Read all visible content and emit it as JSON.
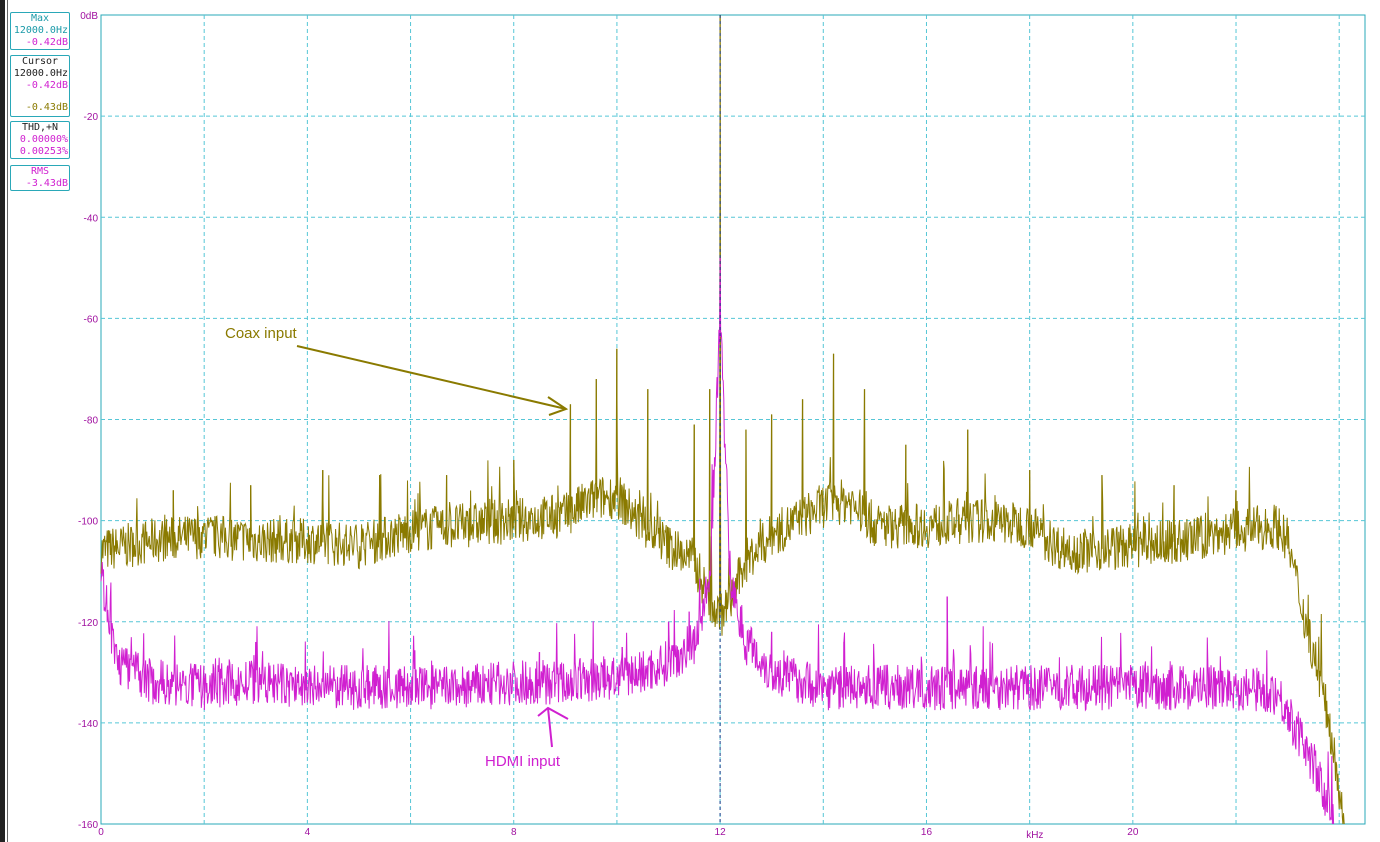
{
  "colors": {
    "coax": "#8a7a00",
    "hdmi": "#d020d0",
    "grid": "#56c6d6",
    "axis_text": "#a010a0",
    "frame": "#2aa8b8",
    "cursor": "#1b3b8a"
  },
  "panel": {
    "max": {
      "title": "Max",
      "freq": "12000.0Hz",
      "level": "-0.42dB"
    },
    "cursor": {
      "title": "Cursor",
      "freq": "12000.0Hz",
      "level_hdmi": "-0.42dB",
      "level_coax": "-0.43dB"
    },
    "thd": {
      "title": "THD,+N",
      "hdmi": "0.00000%",
      "coax": "0.00253%"
    },
    "rms": {
      "title": "RMS",
      "value": "-3.43dB"
    }
  },
  "chart_data": {
    "type": "line",
    "xlabel": "kHz",
    "ylabel": "",
    "xlim": [
      0,
      24.5
    ],
    "ylim": [
      -160,
      0
    ],
    "x_ticks": [
      "0",
      "4",
      "8",
      "12",
      "16",
      "20"
    ],
    "y_ticks": [
      "0dB",
      "-20",
      "-40",
      "-60",
      "-80",
      "-100",
      "-120",
      "-140",
      "-160"
    ],
    "grid": true,
    "cursor_x": 12,
    "series": [
      {
        "key": "coax",
        "noise_floor": [
          [
            0,
            -106
          ],
          [
            1,
            -104
          ],
          [
            2,
            -103
          ],
          [
            3,
            -104
          ],
          [
            4,
            -104
          ],
          [
            5,
            -105
          ],
          [
            6,
            -102
          ],
          [
            7,
            -101
          ],
          [
            8,
            -100
          ],
          [
            9,
            -99
          ],
          [
            9.5,
            -96
          ],
          [
            10,
            -95
          ],
          [
            10.5,
            -101
          ],
          [
            11,
            -105
          ],
          [
            11.5,
            -108
          ],
          [
            11.8,
            -116
          ],
          [
            12,
            -119
          ],
          [
            12.2,
            -116
          ],
          [
            12.5,
            -108
          ],
          [
            13,
            -103
          ],
          [
            13.5,
            -100
          ],
          [
            14,
            -97
          ],
          [
            14.5,
            -96
          ],
          [
            15,
            -101
          ],
          [
            16,
            -101
          ],
          [
            17,
            -100
          ],
          [
            18,
            -101
          ],
          [
            18.5,
            -105
          ],
          [
            19,
            -106
          ],
          [
            20,
            -105
          ],
          [
            21,
            -104
          ],
          [
            22,
            -102
          ],
          [
            22.8,
            -101
          ],
          [
            23,
            -104
          ],
          [
            23.3,
            -118
          ],
          [
            23.6,
            -130
          ],
          [
            23.9,
            -145
          ],
          [
            24.1,
            -160
          ]
        ],
        "peaks": [
          [
            1.4,
            -94
          ],
          [
            2.9,
            -93
          ],
          [
            4.3,
            -90
          ],
          [
            5.4,
            -91
          ],
          [
            6.7,
            -91
          ],
          [
            8.0,
            -88
          ],
          [
            9.1,
            -77
          ],
          [
            9.6,
            -72
          ],
          [
            10.0,
            -66
          ],
          [
            10.6,
            -74
          ],
          [
            11.5,
            -81
          ],
          [
            11.8,
            -74
          ],
          [
            12.0,
            0
          ],
          [
            12.5,
            -82
          ],
          [
            13.0,
            -79
          ],
          [
            13.6,
            -76
          ],
          [
            14.2,
            -67
          ],
          [
            14.8,
            -74
          ],
          [
            15.6,
            -85
          ],
          [
            16.8,
            -82
          ],
          [
            18.0,
            -90
          ],
          [
            19.4,
            -91
          ],
          [
            20.8,
            -93
          ],
          [
            22.0,
            -94
          ]
        ]
      },
      {
        "key": "hdmi",
        "noise_floor": [
          [
            0,
            -110
          ],
          [
            0.3,
            -128
          ],
          [
            1,
            -132
          ],
          [
            2,
            -133
          ],
          [
            3,
            -132
          ],
          [
            4,
            -133
          ],
          [
            5,
            -133
          ],
          [
            6,
            -133
          ],
          [
            7,
            -133
          ],
          [
            8,
            -132
          ],
          [
            9,
            -132
          ],
          [
            10,
            -131
          ],
          [
            10.5,
            -130
          ],
          [
            11,
            -128
          ],
          [
            11.5,
            -124
          ],
          [
            11.8,
            -112
          ],
          [
            12,
            -60
          ],
          [
            12.2,
            -112
          ],
          [
            12.5,
            -124
          ],
          [
            13,
            -130
          ],
          [
            14,
            -133
          ],
          [
            15,
            -133
          ],
          [
            16,
            -133
          ],
          [
            17,
            -133
          ],
          [
            18,
            -133
          ],
          [
            19,
            -133
          ],
          [
            20,
            -133
          ],
          [
            21,
            -133
          ],
          [
            22,
            -133
          ],
          [
            22.8,
            -134
          ],
          [
            23.1,
            -140
          ],
          [
            23.5,
            -148
          ],
          [
            23.9,
            -160
          ]
        ],
        "peaks": [
          [
            3.0,
            -124
          ],
          [
            8.5,
            -126
          ],
          [
            10.1,
            -125
          ],
          [
            11.0,
            -120
          ],
          [
            11.4,
            -118
          ],
          [
            12.0,
            -48
          ],
          [
            12.4,
            -117
          ],
          [
            13.0,
            -122
          ],
          [
            14.4,
            -124
          ],
          [
            16.4,
            -115
          ]
        ]
      }
    ],
    "annotations": [
      {
        "key": "coax",
        "text": "Coax input"
      },
      {
        "key": "hdmi",
        "text": "HDMI input"
      }
    ]
  }
}
